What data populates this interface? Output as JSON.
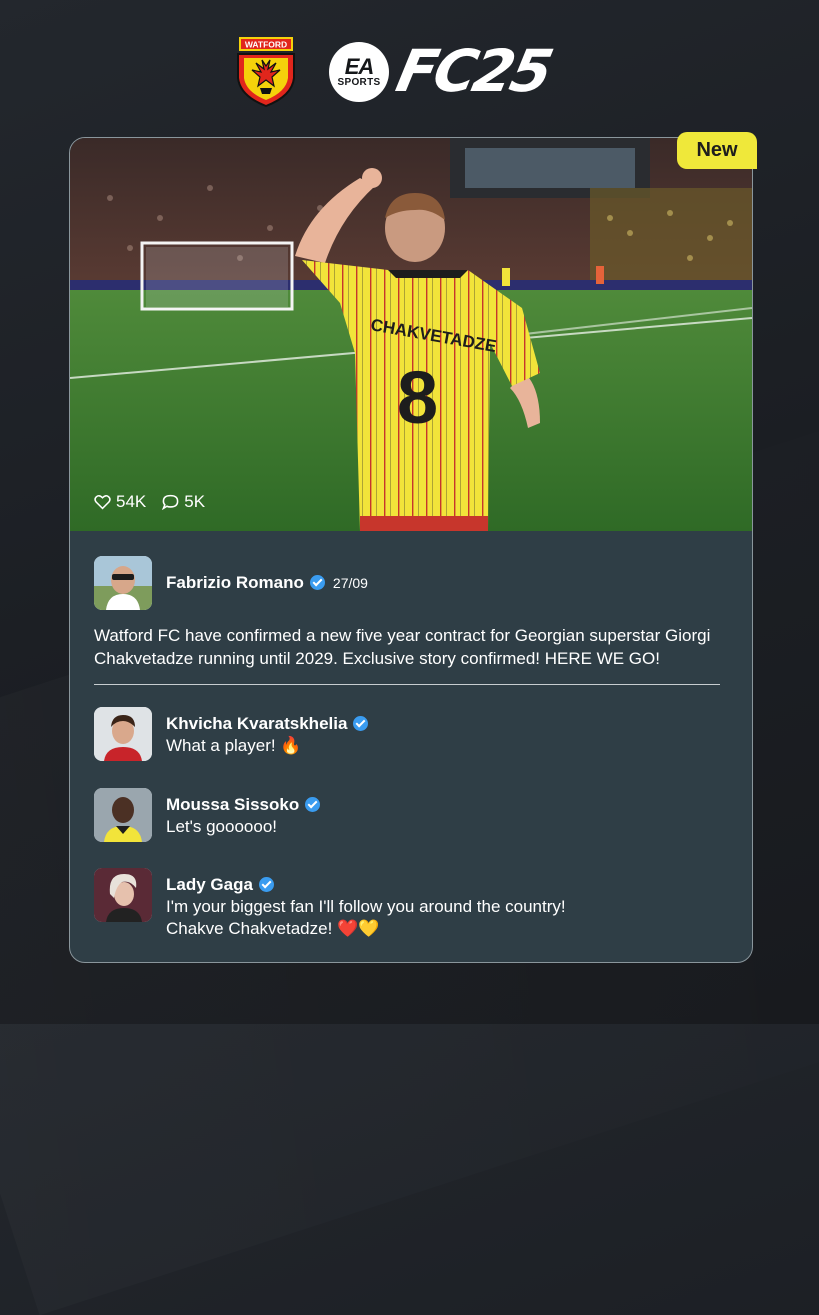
{
  "header": {
    "club_crest_text": "WATFORD",
    "ea_text": "EA",
    "sports_text": "SPORTS",
    "game_logo": "FC25"
  },
  "post": {
    "badge": "New",
    "image_player_name": "CHAKVETADZE",
    "image_player_number": "8",
    "likes": "54K",
    "comments_count": "5K",
    "author": "Fabrizio Romano",
    "date": "27/09",
    "text": "Watford FC have confirmed a new five year contract for Georgian superstar Giorgi Chakvetadze running until 2029. Exclusive story confirmed! HERE WE GO!"
  },
  "comments": [
    {
      "name": "Khvicha Kvaratskhelia",
      "text": "What a player! 🔥"
    },
    {
      "name": "Moussa Sissoko",
      "text": "Let's goooooo!"
    },
    {
      "name": "Lady Gaga",
      "text": "I'm your biggest fan I'll follow you around the country! Chakve Chakvetadze! ❤️💛"
    }
  ],
  "icons": {
    "like": "heart-icon",
    "comment": "comment-bubble-icon",
    "verified": "verified-check-icon"
  },
  "colors": {
    "accent_yellow": "#efe83a",
    "card_bg": "#2f3e46",
    "verified_blue": "#3a9cf0",
    "page_bg": "#1f2227"
  }
}
